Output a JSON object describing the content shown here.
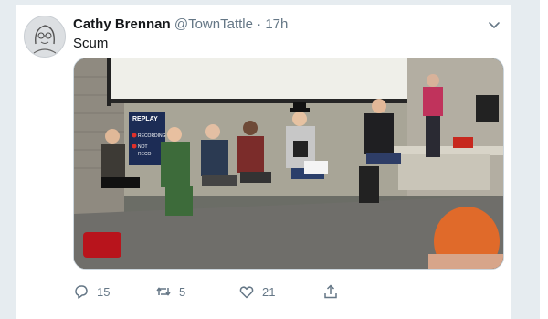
{
  "tweet": {
    "display_name": "Cathy Brennan",
    "handle": "@TownTattle",
    "separator": "·",
    "time": "17h",
    "text": "Scum"
  },
  "media": {
    "sign_title": "REPLAY",
    "sign_line1": "RECORDING",
    "sign_line2": "NOT",
    "sign_line3": "RECO"
  },
  "actions": {
    "reply_count": "15",
    "retweet_count": "5",
    "like_count": "21"
  },
  "icons": {
    "caret": "chevron-down-icon",
    "reply": "reply-icon",
    "retweet": "retweet-icon",
    "like": "heart-icon",
    "share": "share-icon"
  },
  "colors": {
    "text_primary": "#14171a",
    "text_secondary": "#657786",
    "background": "#e6ecf0"
  }
}
